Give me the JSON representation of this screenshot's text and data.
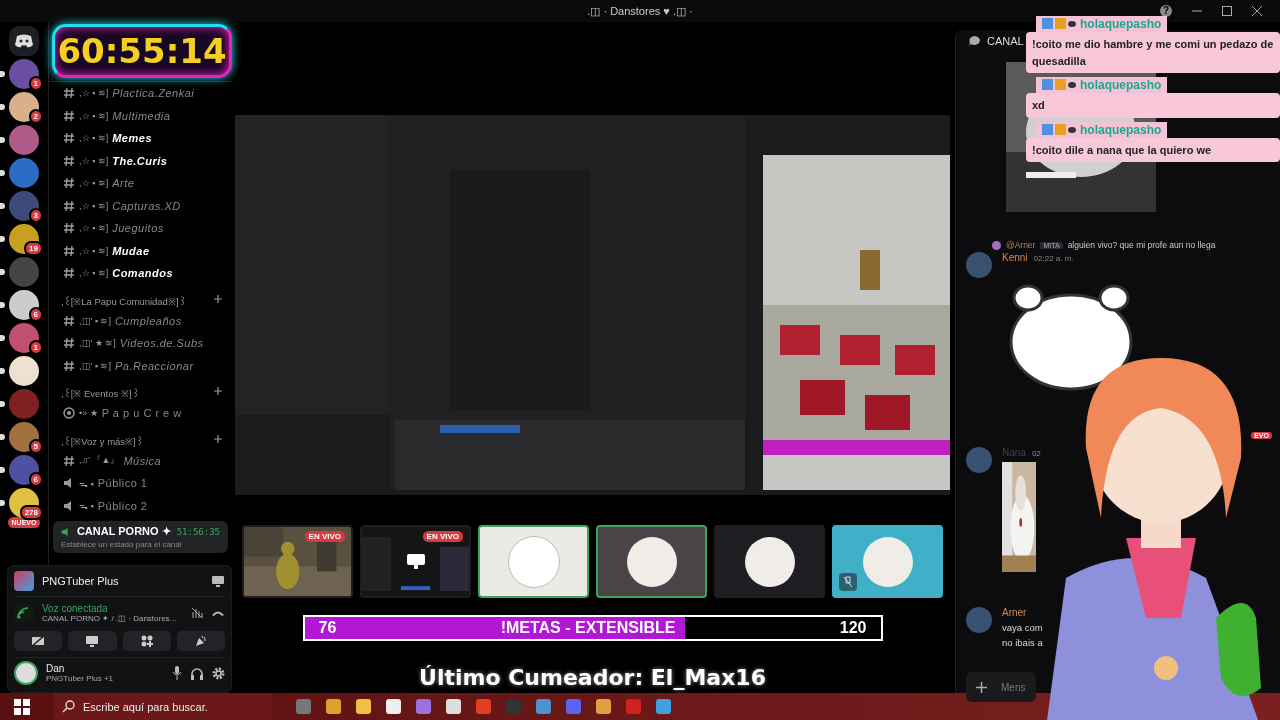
{
  "window": {
    "title": ".◫ · Danstores ♥ .◫ ·",
    "help": "?"
  },
  "timer": {
    "text": "60:55:14"
  },
  "servers": [
    {
      "kind": "badged",
      "badge": "1"
    },
    {
      "kind": "badged",
      "badge": "2"
    },
    {
      "kind": "plain"
    },
    {
      "kind": "plain"
    },
    {
      "kind": "badged",
      "badge": "3"
    },
    {
      "kind": "badged",
      "badge": "19"
    },
    {
      "kind": "plain"
    },
    {
      "kind": "badged",
      "badge": "6"
    },
    {
      "kind": "badged",
      "badge": "1"
    },
    {
      "kind": "plain"
    },
    {
      "kind": "plain"
    },
    {
      "kind": "badged",
      "badge": "5"
    },
    {
      "kind": "badged",
      "badge": "6"
    },
    {
      "kind": "badged",
      "badge": "278"
    }
  ],
  "new_pill": "NUEVO",
  "channel_groups": [
    {
      "channels": [
        {
          "kind": "text",
          "prefix": ",☆ ▪ ≋]",
          "name": "Plactica.Zenkai",
          "unread": false
        },
        {
          "kind": "text",
          "prefix": ",☆ ▪ ≋]",
          "name": "Multimedia",
          "unread": false
        },
        {
          "kind": "text",
          "prefix": ",☆ ▪ ≋]",
          "name": "Memes",
          "unread": true
        },
        {
          "kind": "text",
          "prefix": ",☆ ▪ ≋]",
          "name": "The.Curis",
          "unread": true
        },
        {
          "kind": "text",
          "prefix": ",☆ ▪ ≋]",
          "name": "Arte",
          "unread": false
        },
        {
          "kind": "text",
          "prefix": ",☆ ▪ ≋]",
          "name": "Capturas.XD",
          "unread": false
        },
        {
          "kind": "text",
          "prefix": ",☆ ▪ ≋]",
          "name": "Jueguitos",
          "unread": false
        },
        {
          "kind": "text",
          "prefix": ",☆ ▪ ≋]",
          "name": "Mudae",
          "unread": true
        },
        {
          "kind": "text",
          "prefix": ",☆ ▪ ≋]",
          "name": "Comandos",
          "unread": true
        }
      ]
    },
    {
      "category": ",꒰[※La Papu Comunidad※]꒱",
      "channels": [
        {
          "kind": "text",
          "prefix": ",◫' ▪ ≋]",
          "name": "Cumpleaños",
          "unread": false
        },
        {
          "kind": "text",
          "prefix": ",◫' ★ ≋]",
          "name": "Videos.de.Subs",
          "unread": false
        },
        {
          "kind": "text",
          "prefix": ",◫' ▪ ≋]",
          "name": "Pa.Reaccionar",
          "unread": false
        }
      ]
    },
    {
      "category": ",꒰[※ Eventos ※]꒱",
      "channels": [
        {
          "kind": "stage",
          "prefix": "•» ★",
          "name": "P a p u C r e w",
          "unread": false
        }
      ]
    },
    {
      "category": ",꒰[※Voz y más※]꒱",
      "channels": [
        {
          "kind": "text",
          "prefix": ",♫' 『▲』",
          "name": "Música",
          "unread": false
        },
        {
          "kind": "voice",
          "prefix": "ᯓ ▪",
          "name": "Público 1",
          "unread": false
        },
        {
          "kind": "voice",
          "prefix": "ᯓ ▪",
          "name": "Público 2",
          "unread": false
        }
      ]
    }
  ],
  "active_voice": {
    "name": "CANAL PORNO ✦",
    "time": "51:56:35",
    "status": "Establece un estado para el canal"
  },
  "activity": {
    "name": "PNGTuber Plus"
  },
  "voice_status": {
    "label": "Voz conectada",
    "channel": "CANAL PORNO ✦ / .◫ · Danstores..."
  },
  "user": {
    "name": "Dan",
    "activity": "PNGTuber Plus +1"
  },
  "stage_tiles": [
    {
      "kind": "stream",
      "live_badge": "EN VIVO",
      "speaking": false,
      "muted": false
    },
    {
      "kind": "screen",
      "live_badge": "EN VIVO",
      "speaking": false,
      "muted": false
    },
    {
      "kind": "avatar",
      "speaking": true,
      "muted": false
    },
    {
      "kind": "avatar",
      "speaking": true,
      "muted": false
    },
    {
      "kind": "avatar",
      "speaking": false,
      "muted": false
    },
    {
      "kind": "avatar",
      "speaking": false,
      "muted": true
    }
  ],
  "goal": {
    "current": "76",
    "label": "!METAS - EXTENSIBLE",
    "target": "120",
    "level": 0.66
  },
  "last_cumeador": "Último Cumeador: El_Max16",
  "chat": {
    "header": "CANAL",
    "overlay_messages": [
      {
        "user": "holaquepasho",
        "text": "!coito me dio hambre y me comi un pedazo de quesadilla"
      },
      {
        "user": "holaquepasho",
        "text": "xd"
      },
      {
        "user": "holaquepasho",
        "text": "!coito dile a nana que la quiero we"
      }
    ],
    "reply": {
      "mention": "@Arner",
      "tag": "MITA",
      "text": "alguien vivo? que mi profe aun no llega"
    },
    "messages": [
      {
        "author": "Kenni",
        "time": "02:22 a. m."
      },
      {
        "author": "Nana",
        "time": "02"
      },
      {
        "author": "Arner",
        "lines": [
          "vaya com",
          "no ibais a"
        ]
      }
    ],
    "new_tag": "EVO",
    "input_placeholder": "Mens"
  },
  "taskbar": {
    "search_placeholder": "Escribe aquí para buscar."
  }
}
